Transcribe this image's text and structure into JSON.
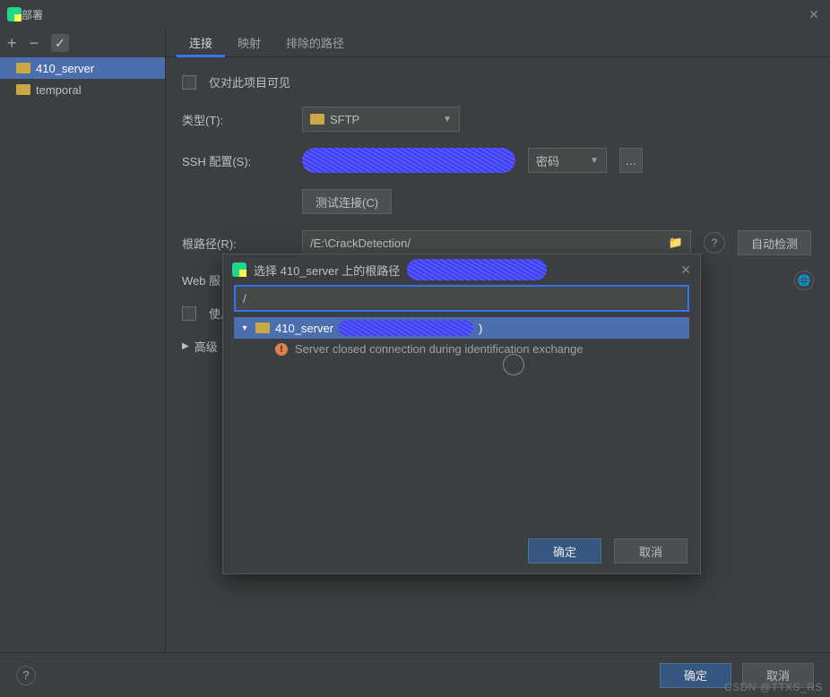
{
  "window": {
    "title": "部署"
  },
  "toolbar": {
    "add": "+",
    "remove": "−",
    "apply": "✓"
  },
  "side_items": [
    {
      "label": "410_server",
      "selected": true
    },
    {
      "label": "temporal",
      "selected": false
    }
  ],
  "tabs": [
    {
      "label": "连接",
      "active": true
    },
    {
      "label": "映射",
      "active": false
    },
    {
      "label": "排除的路径",
      "active": false
    }
  ],
  "form": {
    "visible_only": "仅对此项目可见",
    "type_label": "类型(T):",
    "type_value": "SFTP",
    "ssh_label": "SSH 配置(S):",
    "ssh_auth_hint": "密码",
    "ssh_more": "…",
    "test_btn": "测试连接(C)",
    "root_label": "根路径(R):",
    "root_value": "/E:\\CrackDetection/",
    "autodetect": "自动检测",
    "web_label": "Web 服",
    "use_label": "使用",
    "advanced": "高级"
  },
  "dialog": {
    "title_prefix": "选择 410_server 上的根路径",
    "path_value": "/",
    "tree_node": "410_server",
    "tree_suffix": ")",
    "error_msg": "Server closed connection during identification exchange",
    "ok": "确定",
    "cancel": "取消"
  },
  "footer": {
    "ok": "确定",
    "cancel": "取消"
  },
  "watermark": "CSDN @TTXS_RS"
}
